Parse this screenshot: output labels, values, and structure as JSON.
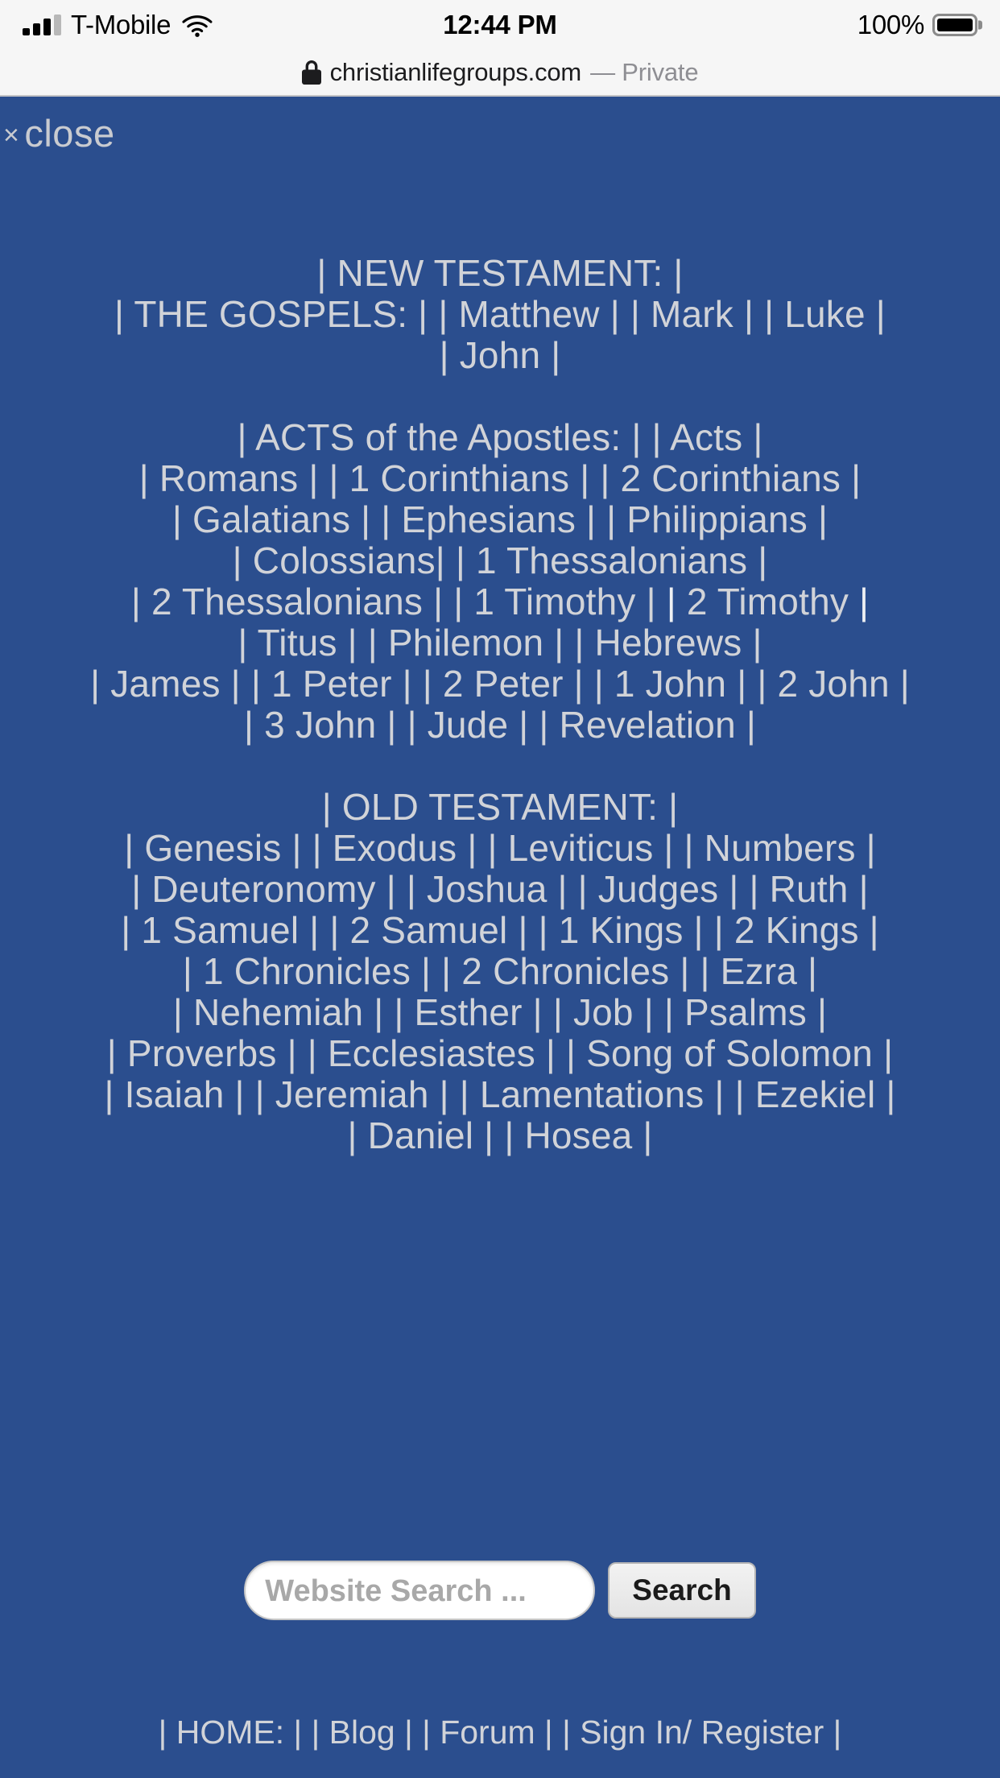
{
  "status_bar": {
    "carrier": "T-Mobile",
    "time": "12:44 PM",
    "battery_percent": "100%",
    "signal_bars_filled": 3,
    "signal_bars_total": 4,
    "wifi": "wifi-icon"
  },
  "browser": {
    "url": "christianlifegroups.com",
    "private_label": "— Private",
    "lock": "lock-icon"
  },
  "overlay": {
    "close_x": "×",
    "close_label": "close"
  },
  "colors": {
    "background_blue": "#2b4e8e",
    "link_text": "#d1d3d8",
    "active_link": "#eef0f3",
    "statusbar_bg": "#f6f6f6",
    "search_button_bg": "#e9e9e9"
  },
  "nav": {
    "lines": [
      {
        "id": "nt-heading",
        "items": [
          "NEW TESTAMENT:"
        ],
        "group": "new-testament"
      },
      {
        "id": "gospels",
        "items": [
          "THE GOSPELS:",
          "Matthew",
          "Mark",
          "Luke"
        ],
        "group": "new-testament"
      },
      {
        "id": "john",
        "items": [
          "John"
        ],
        "group": "new-testament"
      },
      {
        "id": "gap-1",
        "items": [],
        "group": "spacer"
      },
      {
        "id": "acts",
        "items": [
          "ACTS of the Apostles:",
          "Acts"
        ],
        "group": "new-testament"
      },
      {
        "id": "epistles-1",
        "items": [
          "Romans",
          "1 Corinthians",
          "2 Corinthians"
        ],
        "group": "new-testament"
      },
      {
        "id": "epistles-2",
        "items": [
          "Galatians",
          "Ephesians",
          "Philippians"
        ],
        "group": "new-testament"
      },
      {
        "id": "epistles-3",
        "items": [
          "Colossians",
          "1 Thessalonians"
        ],
        "group": "new-testament",
        "tight_first": true
      },
      {
        "id": "epistles-4",
        "items": [
          "2 Thessalonians",
          "1 Timothy",
          "2 Timothy"
        ],
        "group": "new-testament",
        "active": "2 Timothy"
      },
      {
        "id": "epistles-5",
        "items": [
          "Titus",
          "Philemon",
          "Hebrews"
        ],
        "group": "new-testament"
      },
      {
        "id": "epistles-6",
        "items": [
          "James",
          "1 Peter",
          "2 Peter",
          "1 John",
          "2 John"
        ],
        "group": "new-testament"
      },
      {
        "id": "epistles-7",
        "items": [
          "3 John",
          "Jude",
          "Revelation"
        ],
        "group": "new-testament"
      },
      {
        "id": "gap-2",
        "items": [],
        "group": "spacer"
      },
      {
        "id": "ot-heading",
        "items": [
          "OLD TESTAMENT:"
        ],
        "group": "old-testament"
      },
      {
        "id": "ot-1",
        "items": [
          "Genesis",
          "Exodus",
          "Leviticus",
          "Numbers"
        ],
        "group": "old-testament"
      },
      {
        "id": "ot-2",
        "items": [
          "Deuteronomy",
          "Joshua",
          "Judges",
          "Ruth"
        ],
        "group": "old-testament"
      },
      {
        "id": "ot-3",
        "items": [
          "1 Samuel",
          "2 Samuel",
          "1 Kings",
          "2 Kings"
        ],
        "group": "old-testament"
      },
      {
        "id": "ot-4",
        "items": [
          "1 Chronicles",
          "2 Chronicles",
          "Ezra"
        ],
        "group": "old-testament"
      },
      {
        "id": "ot-5",
        "items": [
          "Nehemiah",
          "Esther",
          "Job",
          "Psalms"
        ],
        "group": "old-testament"
      },
      {
        "id": "ot-6",
        "items": [
          "Proverbs",
          "Ecclesiastes",
          "Song of Solomon"
        ],
        "group": "old-testament"
      },
      {
        "id": "ot-7",
        "items": [
          "Isaiah",
          "Jeremiah",
          "Lamentations",
          "Ezekiel"
        ],
        "group": "old-testament"
      },
      {
        "id": "ot-8",
        "items": [
          "Daniel",
          "Hosea"
        ],
        "group": "old-testament"
      }
    ]
  },
  "search": {
    "placeholder": "Website Search ...",
    "value": "",
    "button_label": "Search"
  },
  "footer": {
    "items": [
      "HOME:",
      "Blog",
      "Forum",
      "Sign In/ Register"
    ]
  }
}
